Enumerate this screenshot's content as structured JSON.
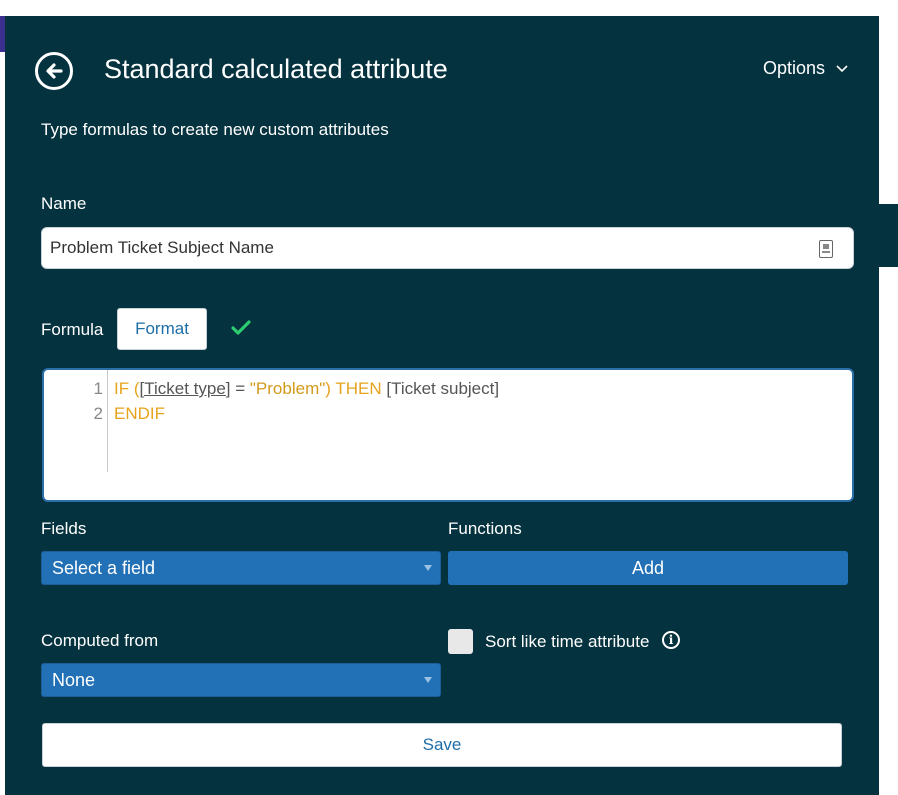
{
  "header": {
    "title": "Standard calculated attribute",
    "options_label": "Options"
  },
  "subtitle": "Type formulas to create new custom attributes",
  "name": {
    "label": "Name",
    "value": "Problem Ticket Subject Name"
  },
  "formula": {
    "label": "Formula",
    "format_label": "Format",
    "lines": [
      {
        "num": "1"
      },
      {
        "num": "2"
      }
    ],
    "tokens": {
      "if": "IF (",
      "field1": "[Ticket type]",
      "eq": " = ",
      "str": "\"Problem\"",
      "then": ") THEN ",
      "field2": "[Ticket subject]",
      "endif": "ENDIF"
    }
  },
  "fields": {
    "label": "Fields",
    "selected": "Select a field"
  },
  "functions": {
    "label": "Functions",
    "add_label": "Add"
  },
  "computed_from": {
    "label": "Computed from",
    "selected": "None"
  },
  "sort_like_time": {
    "label": "Sort like time attribute",
    "checked": false
  },
  "save_label": "Save",
  "colors": {
    "panel": "#04323e",
    "accent_blue": "#2270b5",
    "success_green": "#2ecc71",
    "keyword": "#e6a31b"
  }
}
